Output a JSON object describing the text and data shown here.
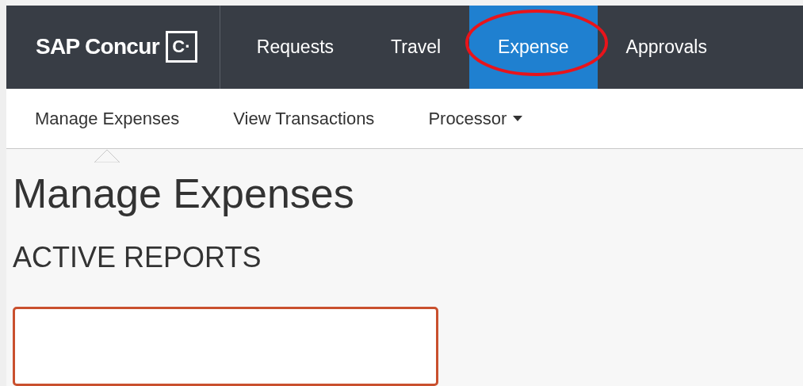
{
  "header": {
    "logo": "SAP Concur",
    "logo_mark": "C·",
    "tabs": [
      {
        "label": "Requests",
        "selected": false,
        "circled": false
      },
      {
        "label": "Travel",
        "selected": false,
        "circled": false
      },
      {
        "label": "Expense",
        "selected": true,
        "circled": true
      },
      {
        "label": "Approvals",
        "selected": false,
        "circled": false
      }
    ]
  },
  "subnav": [
    {
      "label": "Manage Expenses",
      "selected": true,
      "dropdown": false
    },
    {
      "label": "View Transactions",
      "selected": false,
      "dropdown": false
    },
    {
      "label": "Processor",
      "selected": false,
      "dropdown": true
    }
  ],
  "page": {
    "title": "Manage Expenses",
    "section": "ACTIVE REPORTS",
    "cards": [
      {
        "kind": "report-card"
      }
    ]
  }
}
